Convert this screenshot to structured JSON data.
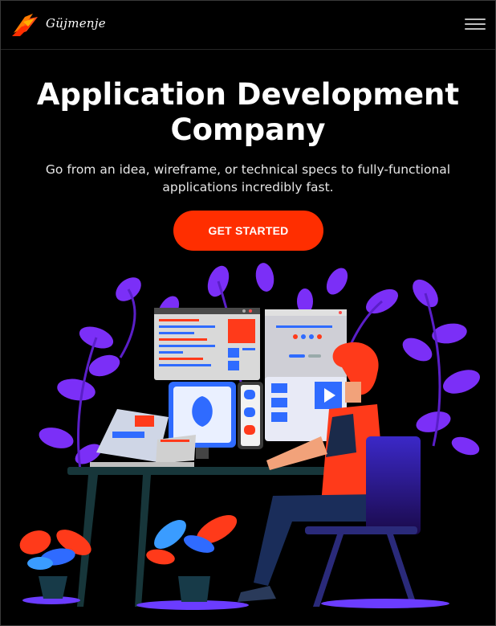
{
  "header": {
    "brand_name": "Güjmenje",
    "logo_icon": "brush-stroke-logo-icon",
    "menu_icon": "hamburger-menu-icon"
  },
  "hero": {
    "title_line1": "Application Development",
    "title_line2": "Company",
    "subtitle": "Go from an idea, wireframe, or technical specs to fully-functional applications incredibly fast.",
    "cta_label": "GET STARTED",
    "illustration_icon": "developer-at-desk-illustration"
  },
  "colors": {
    "background": "#000000",
    "accent": "#ff2e00",
    "leaf_purple": "#7b2ff7"
  }
}
